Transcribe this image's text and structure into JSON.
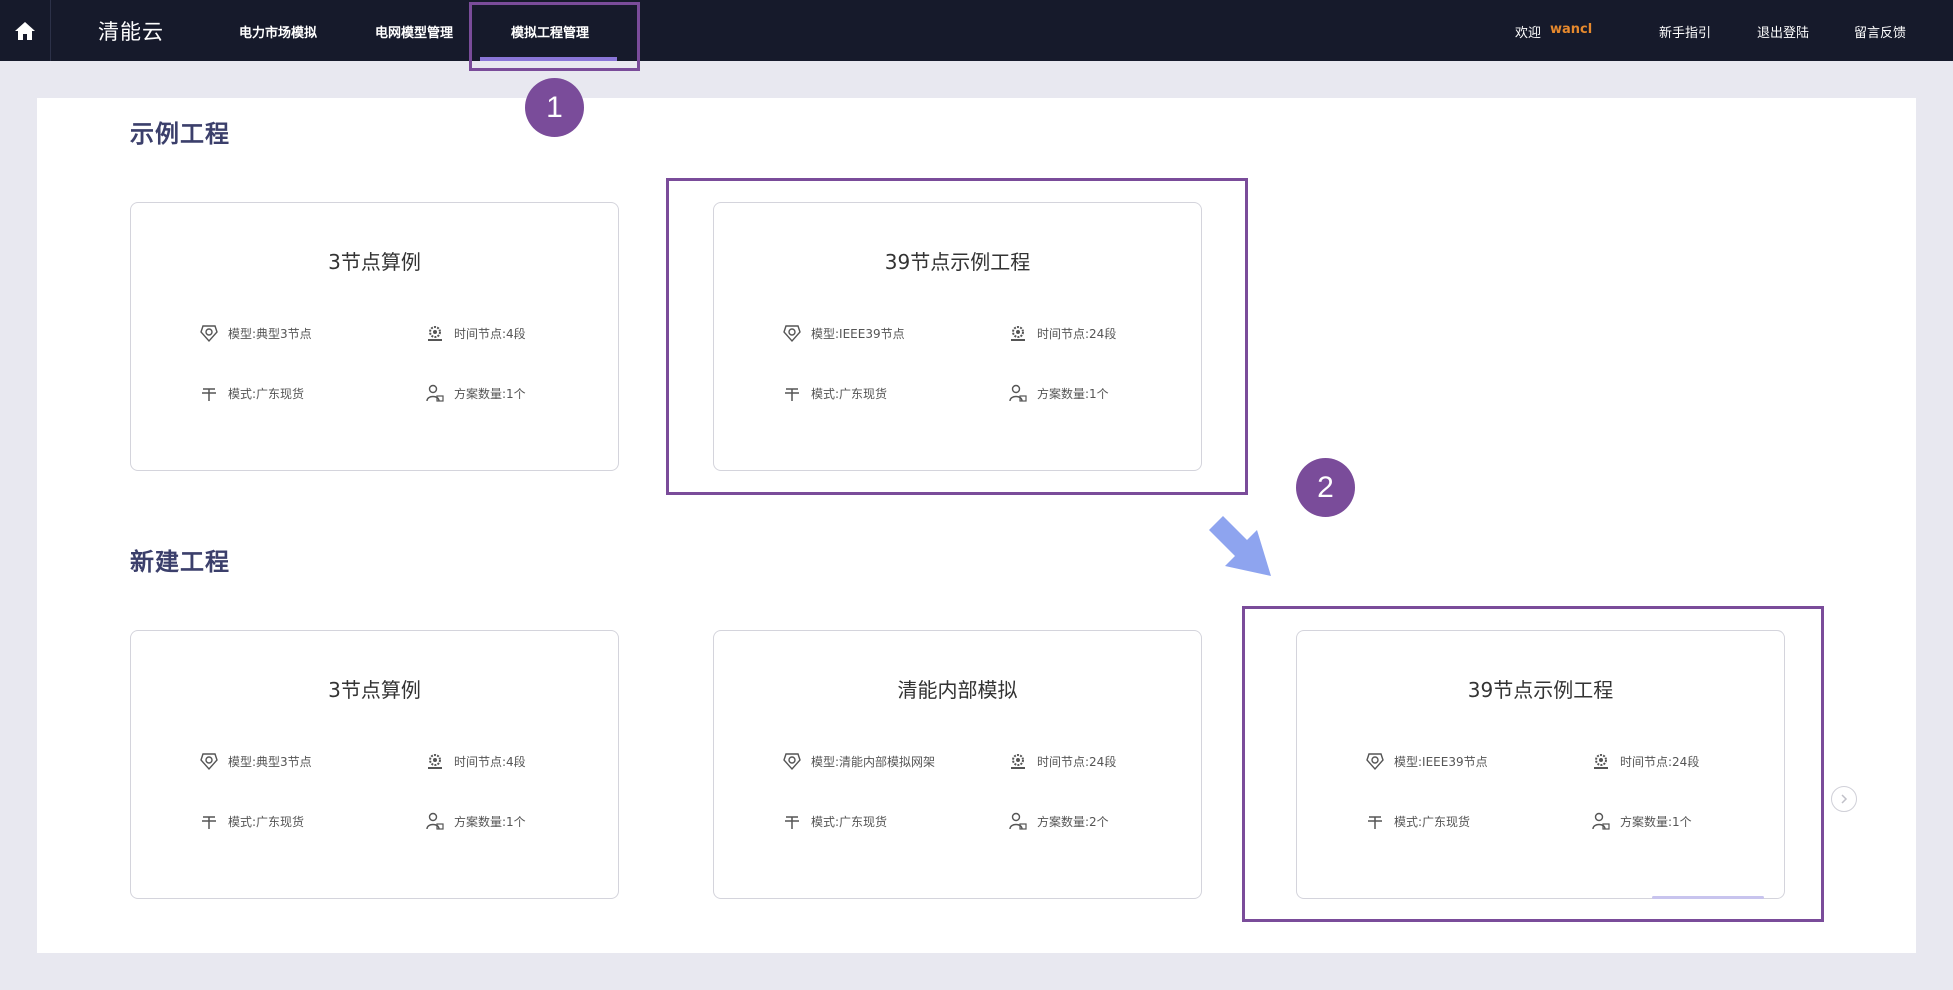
{
  "app": {
    "brand": "清能云"
  },
  "nav": {
    "items": [
      {
        "label": "电力市场模拟"
      },
      {
        "label": "电网模型管理"
      },
      {
        "label": "模拟工程管理"
      }
    ]
  },
  "user": {
    "welcome": "欢迎",
    "name": "wancl",
    "links": [
      "新手指引",
      "退出登陆",
      "留言反馈"
    ]
  },
  "sections": {
    "examples": {
      "title": "示例工程",
      "cards": [
        {
          "title": "3节点算例",
          "model": "模型:典型3节点",
          "time": "时间节点:4段",
          "mode": "模式:广东现货",
          "plans": "方案数量:1个"
        },
        {
          "title": "39节点示例工程",
          "model": "模型:IEEE39节点",
          "time": "时间节点:24段",
          "mode": "模式:广东现货",
          "plans": "方案数量:1个"
        }
      ]
    },
    "new": {
      "title": "新建工程",
      "cards": [
        {
          "title": "3节点算例",
          "model": "模型:典型3节点",
          "time": "时间节点:4段",
          "mode": "模式:广东现货",
          "plans": "方案数量:1个"
        },
        {
          "title": "清能内部模拟",
          "model": "模型:清能内部模拟网架",
          "time": "时间节点:24段",
          "mode": "模式:广东现货",
          "plans": "方案数量:2个"
        },
        {
          "title": "39节点示例工程",
          "model": "模型:IEEE39节点",
          "time": "时间节点:24段",
          "mode": "模式:广东现货",
          "plans": "方案数量:1个"
        }
      ]
    }
  },
  "annotations": {
    "badge1": "1",
    "badge2": "2",
    "color": "#7a4c9a",
    "arrow_color": "#8ea4ef"
  },
  "icons": {
    "home": "home-icon",
    "model": "model-icon",
    "time": "clock-gear-icon",
    "mode": "mode-icon",
    "plans": "user-plan-icon",
    "next": "chevron-right-icon"
  }
}
